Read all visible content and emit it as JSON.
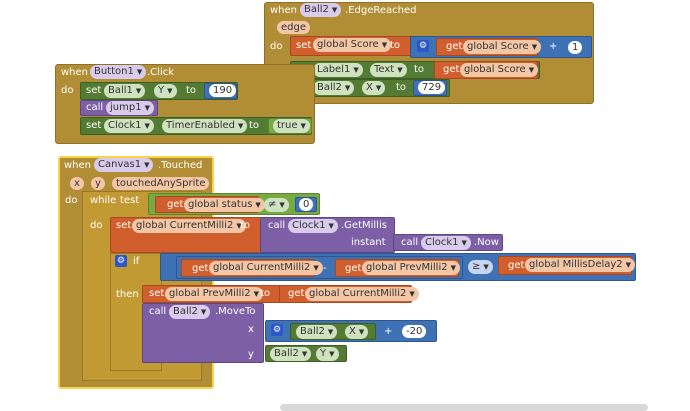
{
  "kw": {
    "when": "when",
    "do": "do",
    "set": "set",
    "to": "to",
    "call": "call",
    "get": "get",
    "while": "while",
    "test": "test",
    "if": "if",
    "then": "then",
    "instant": "instant",
    "x": "x",
    "y": "y"
  },
  "edge_block": {
    "component": "Ball2",
    "event": ".EdgeReached",
    "param": "edge",
    "row1": {
      "var": "global Score",
      "get": "global Score",
      "op": "+",
      "num": "1"
    },
    "row2": {
      "comp": "Label1",
      "prop": "Text",
      "get": "global Score"
    },
    "row3": {
      "comp": "Ball2",
      "prop": "X",
      "num": "729"
    }
  },
  "button_block": {
    "component": "Button1",
    "event": ".Click",
    "row1": {
      "comp": "Ball1",
      "prop": "Y",
      "num": "190"
    },
    "row2": {
      "proc": "jump1"
    },
    "row3": {
      "comp": "Clock1",
      "prop": "TimerEnabled",
      "bool": "true"
    }
  },
  "canvas_block": {
    "component": "Canvas1",
    "event": ".Touched",
    "param_any": "touchedAnySprite",
    "while_test": {
      "get": "global status",
      "op": "≠",
      "num": "0"
    },
    "set_current": {
      "var": "global CurrentMilli2",
      "comp": "Clock1",
      "method": ".GetMillis",
      "inner_comp": "Clock1",
      "inner_method": ".Now"
    },
    "if_cond": {
      "get1": "global CurrentMilli2",
      "minus": "-",
      "get2": "global PrevMilli2",
      "op": "≥",
      "get3": "global MillisDelay2"
    },
    "then_set": {
      "var": "global PrevMilli2",
      "get": "global CurrentMilli2"
    },
    "moveto": {
      "comp": "Ball2",
      "method": ".MoveTo",
      "x_comp": "Ball2",
      "x_prop": "X",
      "op": "+",
      "num": "-20",
      "y_comp": "Ball2",
      "y_prop": "Y"
    }
  },
  "icons": {
    "dropdown": "chevron-down-icon",
    "mutator": "gear-icon"
  },
  "colors": {
    "event": "#b18e35",
    "variable": "#d05f2d",
    "component": "#547b33",
    "math": "#3f71b5",
    "procedure": "#7d5fa6",
    "logic": "#77ab41",
    "selected": "#f7d54a"
  }
}
